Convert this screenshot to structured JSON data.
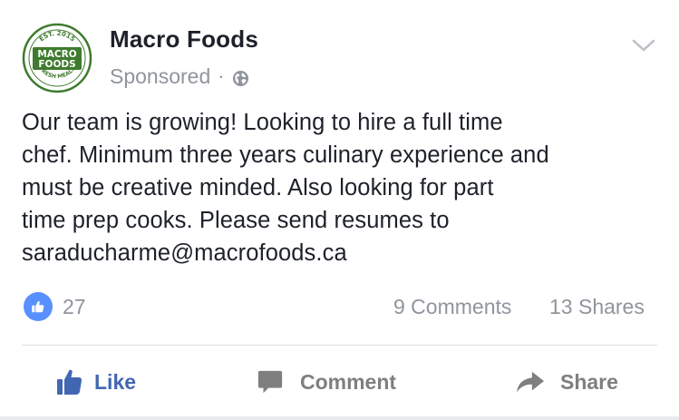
{
  "post": {
    "page_name": "Macro Foods",
    "sponsored_label": "Sponsored",
    "separator": "·",
    "audience_icon": "globe-icon",
    "menu_icon": "chevron-down-icon",
    "avatar": {
      "top_text": "EST. 2015",
      "logo_line1": "MACRO",
      "logo_line2": "FOODS",
      "bottom_text": "FRESH MEALS"
    },
    "text_lines": [
      "Our team is growing! Looking to hire a full time",
      "chef. Minimum three years culinary experience and",
      "must be creative minded. Also looking for part",
      "time prep cooks. Please send resumes to",
      "saraducharme@macrofoods.ca"
    ]
  },
  "stats": {
    "likes": "27",
    "comments": "9 Comments",
    "shares": "13 Shares"
  },
  "actions": {
    "like_label": "Like",
    "comment_label": "Comment",
    "share_label": "Share"
  },
  "colors": {
    "accent_blue": "#4267b2",
    "like_badge": "#5890ff",
    "muted_text": "#90949c",
    "avatar_green": "#3f7b2e"
  }
}
